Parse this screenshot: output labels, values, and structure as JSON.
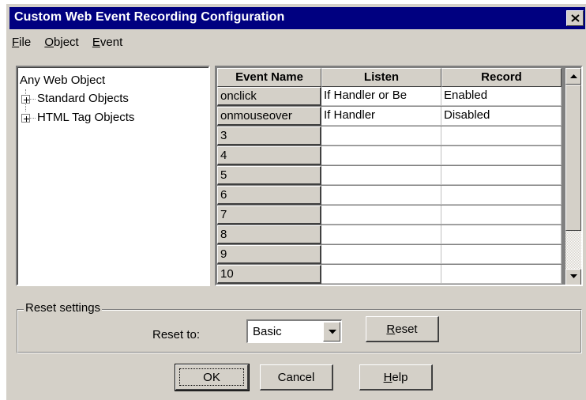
{
  "window": {
    "title": "Custom Web Event Recording Configuration"
  },
  "menubar": [
    {
      "mnemonic": "F",
      "rest": "ile"
    },
    {
      "mnemonic": "O",
      "rest": "bject"
    },
    {
      "mnemonic": "E",
      "rest": "vent"
    }
  ],
  "tree": {
    "root": "Any Web Object",
    "nodes": [
      "Standard Objects",
      "HTML Tag Objects"
    ]
  },
  "grid": {
    "columns": [
      "Event Name",
      "Listen",
      "Record"
    ],
    "rows": [
      {
        "event": "onclick",
        "listen": "If Handler or Be",
        "record": "Enabled"
      },
      {
        "event": "onmouseover",
        "listen": "If Handler",
        "record": "Disabled"
      },
      {
        "event": "3",
        "listen": "",
        "record": ""
      },
      {
        "event": "4",
        "listen": "",
        "record": ""
      },
      {
        "event": "5",
        "listen": "",
        "record": ""
      },
      {
        "event": "6",
        "listen": "",
        "record": ""
      },
      {
        "event": "7",
        "listen": "",
        "record": ""
      },
      {
        "event": "8",
        "listen": "",
        "record": ""
      },
      {
        "event": "9",
        "listen": "",
        "record": ""
      },
      {
        "event": "10",
        "listen": "",
        "record": ""
      }
    ]
  },
  "reset": {
    "group_label": "Reset settings",
    "reset_to_label": "Reset to:",
    "selected": "Basic",
    "button_mnemonic": "R",
    "button_rest": "eset"
  },
  "buttons": {
    "ok_label": "OK",
    "cancel_label": "Cancel",
    "help_mnemonic": "H",
    "help_rest": "elp"
  },
  "icons": {
    "close": "close-icon",
    "expand": "plus-box-icon",
    "scroll_up": "arrow-up-icon",
    "scroll_down": "arrow-down-icon",
    "dropdown": "arrow-down-icon"
  }
}
